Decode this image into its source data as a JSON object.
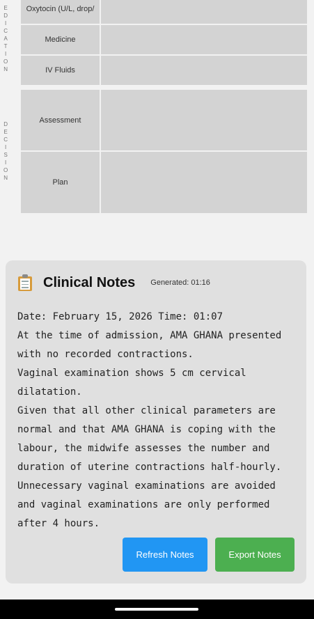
{
  "side_labels": {
    "medication": [
      "E",
      "D",
      "I",
      "C",
      "A",
      "T",
      "I",
      "O",
      "N"
    ],
    "decision": [
      "D",
      "E",
      "C",
      "I",
      "S",
      "I",
      "O",
      "N"
    ]
  },
  "medication_rows": [
    {
      "label": "Oxytocin (U/L, drop/"
    },
    {
      "label": "Medicine"
    },
    {
      "label": "IV Fluids"
    }
  ],
  "decision_rows": [
    {
      "label": "Assessment"
    },
    {
      "label": "Plan"
    }
  ],
  "clinical_notes": {
    "title": "Clinical Notes",
    "generated": "Generated: 01:16",
    "icon": "clipboard-icon",
    "lines": [
      "Date: February 15, 2026 Time: 01:07",
      "At the time of admission, AMA GHANA presented with no recorded contractions.",
      "Vaginal examination shows 5 cm cervical dilatation.",
      "Given that all other clinical parameters are normal and that AMA GHANA is coping with the labour, the midwife assesses the number and duration of uterine contractions half-hourly.",
      "Unnecessary vaginal examinations are avoided and vaginal examinations are only performed after 4 hours."
    ],
    "refresh_label": "Refresh Notes",
    "export_label": "Export Notes"
  },
  "colors": {
    "refresh": "#2196f3",
    "export": "#4caf50",
    "cell": "#d3d3d3",
    "card": "#e0e0e0"
  }
}
